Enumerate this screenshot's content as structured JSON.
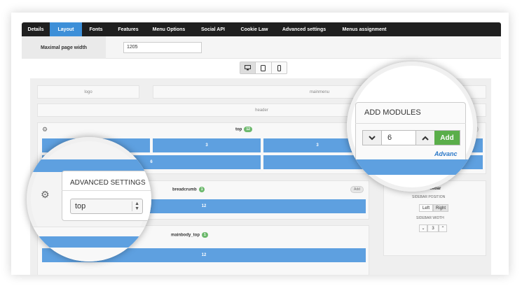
{
  "tabs": [
    "Details",
    "Layout",
    "Fonts",
    "Features",
    "Menu Options",
    "Social API",
    "Cookie Law",
    "Advanced settings",
    "Menus assignment"
  ],
  "active_tab": "Layout",
  "page_width": {
    "label": "Maximal page width",
    "value": "1205"
  },
  "devices": [
    "desktop-icon",
    "tablet-icon",
    "phone-icon"
  ],
  "layout": {
    "logo": "logo",
    "mainmenu": "mainmenu",
    "header": "header",
    "top": {
      "title": "top",
      "badge": "12",
      "cells": [
        "3",
        "3",
        "6"
      ]
    },
    "breadcrumb": {
      "title": "breadcrumb",
      "badge": "1",
      "cell": "12"
    },
    "mainbody_top": {
      "title": "mainbody_top",
      "badge": "1",
      "cell": "12"
    },
    "add_label": "Add",
    "sidebar": {
      "title": "sidebar",
      "position_label": "SIDEBAR POSITION",
      "left": "Left",
      "right": "Right",
      "width_label": "SIDEBAR WIDTH",
      "width_value": "3"
    }
  },
  "add_modules": {
    "title": "ADD MODULES",
    "value": "6",
    "add_button": "Add",
    "advanced_link": "Advanc"
  },
  "advanced_settings": {
    "title": "ADVANCED SETTINGS",
    "select_value": "top"
  }
}
